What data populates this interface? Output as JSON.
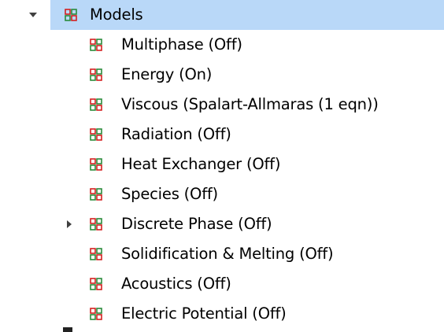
{
  "tree": {
    "parent": {
      "label": "Models",
      "icon": "model-group-icon",
      "expanded": true,
      "selected": true
    },
    "children": [
      {
        "label": "Multiphase (Off)",
        "icon": "model-icon",
        "expandable": false
      },
      {
        "label": "Energy (On)",
        "icon": "model-icon",
        "expandable": false
      },
      {
        "label": "Viscous (Spalart-Allmaras (1 eqn))",
        "icon": "model-icon",
        "expandable": false
      },
      {
        "label": "Radiation (Off)",
        "icon": "model-icon",
        "expandable": false
      },
      {
        "label": "Heat Exchanger (Off)",
        "icon": "model-icon",
        "expandable": false
      },
      {
        "label": "Species (Off)",
        "icon": "model-icon",
        "expandable": false
      },
      {
        "label": "Discrete Phase (Off)",
        "icon": "model-icon",
        "expandable": true
      },
      {
        "label": "Solidification & Melting (Off)",
        "icon": "model-icon",
        "expandable": false
      },
      {
        "label": "Acoustics (Off)",
        "icon": "model-icon",
        "expandable": false
      },
      {
        "label": "Electric Potential (Off)",
        "icon": "model-icon",
        "expandable": false
      }
    ]
  },
  "colors": {
    "selection_bg": "#b9d8f8",
    "icon_red": "#d42020",
    "icon_green": "#2a8a3a",
    "icon_dark": "#3a3a3a"
  }
}
